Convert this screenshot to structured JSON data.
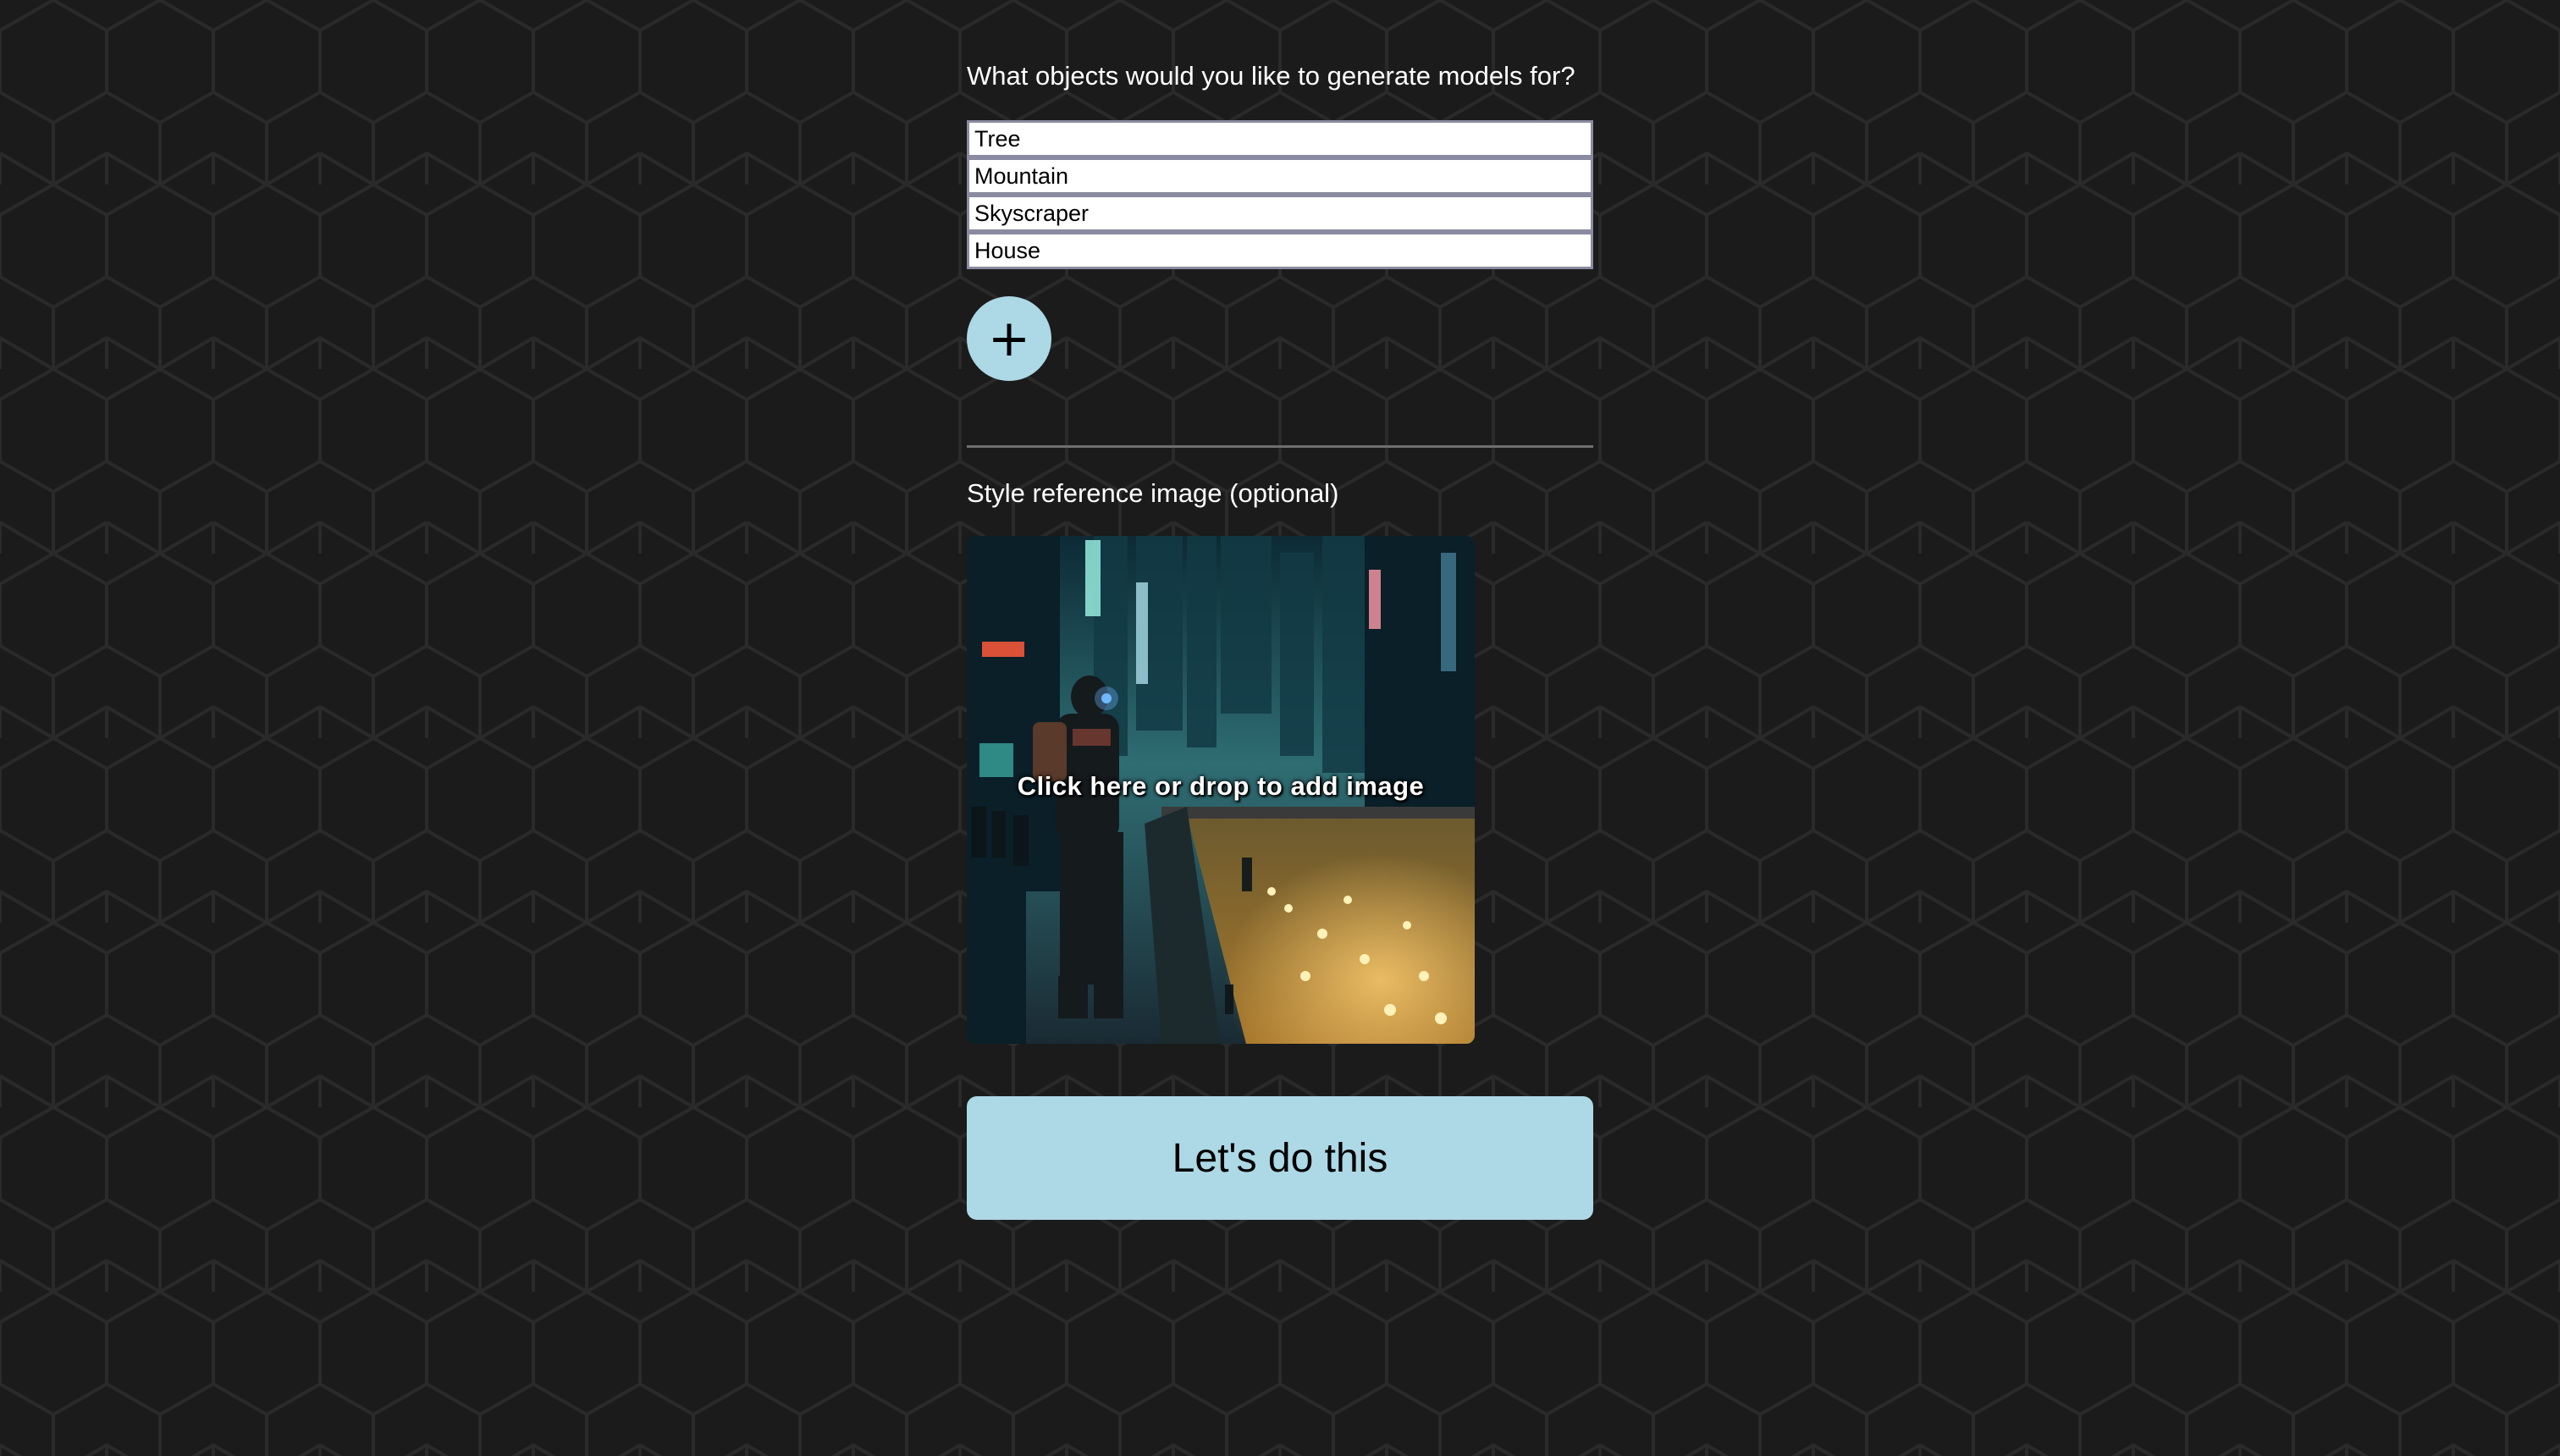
{
  "form": {
    "question": "What objects would you like to generate models for?",
    "objects": [
      {
        "value": "Tree"
      },
      {
        "value": "Mountain"
      },
      {
        "value": "Skyscraper"
      },
      {
        "value": "House"
      }
    ],
    "add_button": {
      "label": "+",
      "icon": "plus-icon"
    },
    "style_label": "Style reference image (optional)",
    "dropzone_text": "Click here or drop to add image",
    "submit_label": "Let's do this"
  },
  "colors": {
    "background": "#1b1b1b",
    "hex_lines": "#2a2a2a",
    "accent": "#add8e6",
    "divider": "#6f6f6f",
    "input_border": "#8a8aa0"
  }
}
